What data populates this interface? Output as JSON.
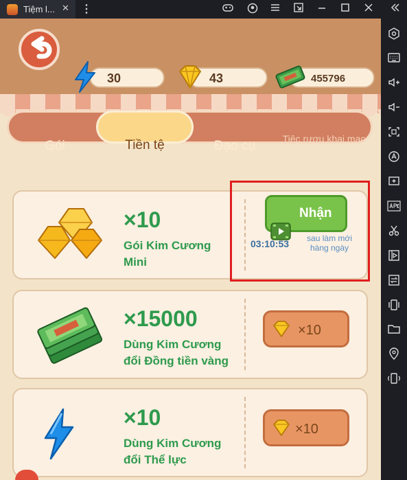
{
  "window": {
    "tab_title": "Tiệm l...",
    "tab_close": "✕",
    "kebab": "⋮",
    "controls": [
      "gamepad-icon",
      "account-icon",
      "menu-icon",
      "popout-icon",
      "minimize-icon",
      "maximize-icon",
      "close-icon",
      "collapse-icon"
    ]
  },
  "sidebar": {
    "icons": [
      "settings-hex-icon",
      "keyboard-icon",
      "volume-up-icon",
      "volume-down-icon",
      "fullscreen-icon",
      "auto-icon",
      "screenshot-icon",
      "apk-icon",
      "cut-icon",
      "media-icon",
      "sync-icon",
      "shake-icon",
      "folder-icon",
      "location-icon",
      "rotate-icon"
    ]
  },
  "header": {
    "energy": "30",
    "diamonds": "43",
    "money": "455796"
  },
  "tabs": [
    "Gói",
    "Tiền tệ",
    "Đạo cụ",
    "Tiệc rượu khai mạc"
  ],
  "active_tab": "Tiền tệ",
  "items": [
    {
      "qty": "×10",
      "desc1": "Gói Kim Cương",
      "desc2": "Mini",
      "button": "Nhận",
      "timer": "03:10:53",
      "refresh": "sau làm mới hàng ngày"
    },
    {
      "qty": "×15000",
      "desc1": "Dùng Kim Cương",
      "desc2": "đổi Đồng tiền vàng",
      "price": "×10"
    },
    {
      "qty": "×10",
      "desc1": "Dùng Kim Cương",
      "desc2": "đổi Thể lực",
      "price": "×10"
    }
  ],
  "colors": {
    "green_text": "#2e9a4d",
    "highlight": "#e01e1e",
    "tab_active": "#fbd78a",
    "tab_bar": "#d27e60"
  }
}
